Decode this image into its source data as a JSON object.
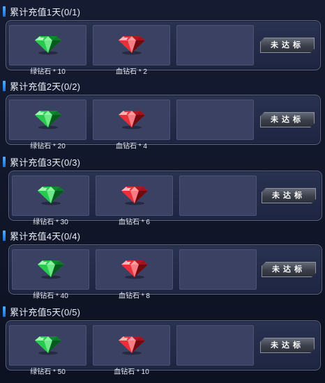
{
  "colors": {
    "accent": "#3d8fe8",
    "card_bg": "#262d4b",
    "slot_bg": "#3b4163",
    "button_bg": "#4a4f5a",
    "green_gem": "#22c04a",
    "red_gem": "#e8323c"
  },
  "rewards": [
    {
      "title": "累计充值1天(0/1)",
      "items": [
        {
          "icon": "green-diamond-icon",
          "label": "绿钻石 * 10"
        },
        {
          "icon": "red-diamond-icon",
          "label": "血钻石 * 2"
        }
      ],
      "button": "未达标"
    },
    {
      "title": "累计充值2天(0/2)",
      "items": [
        {
          "icon": "green-diamond-icon",
          "label": "绿钻石 * 20"
        },
        {
          "icon": "red-diamond-icon",
          "label": "血钻石 * 4"
        }
      ],
      "button": "未达标"
    },
    {
      "title": "累计充值3天(0/3)",
      "items": [
        {
          "icon": "green-diamond-icon",
          "label": "绿钻石 * 30"
        },
        {
          "icon": "red-diamond-icon",
          "label": "血钻石 * 6"
        }
      ],
      "button": "未达标"
    },
    {
      "title": "累计充值4天(0/4)",
      "items": [
        {
          "icon": "green-diamond-icon",
          "label": "绿钻石 * 40"
        },
        {
          "icon": "red-diamond-icon",
          "label": "血钻石 * 8"
        }
      ],
      "button": "未达标"
    },
    {
      "title": "累计充值5天(0/5)",
      "items": [
        {
          "icon": "green-diamond-icon",
          "label": "绿钻石 * 50"
        },
        {
          "icon": "red-diamond-icon",
          "label": "血钻石 * 10"
        }
      ],
      "button": "未达标"
    }
  ]
}
